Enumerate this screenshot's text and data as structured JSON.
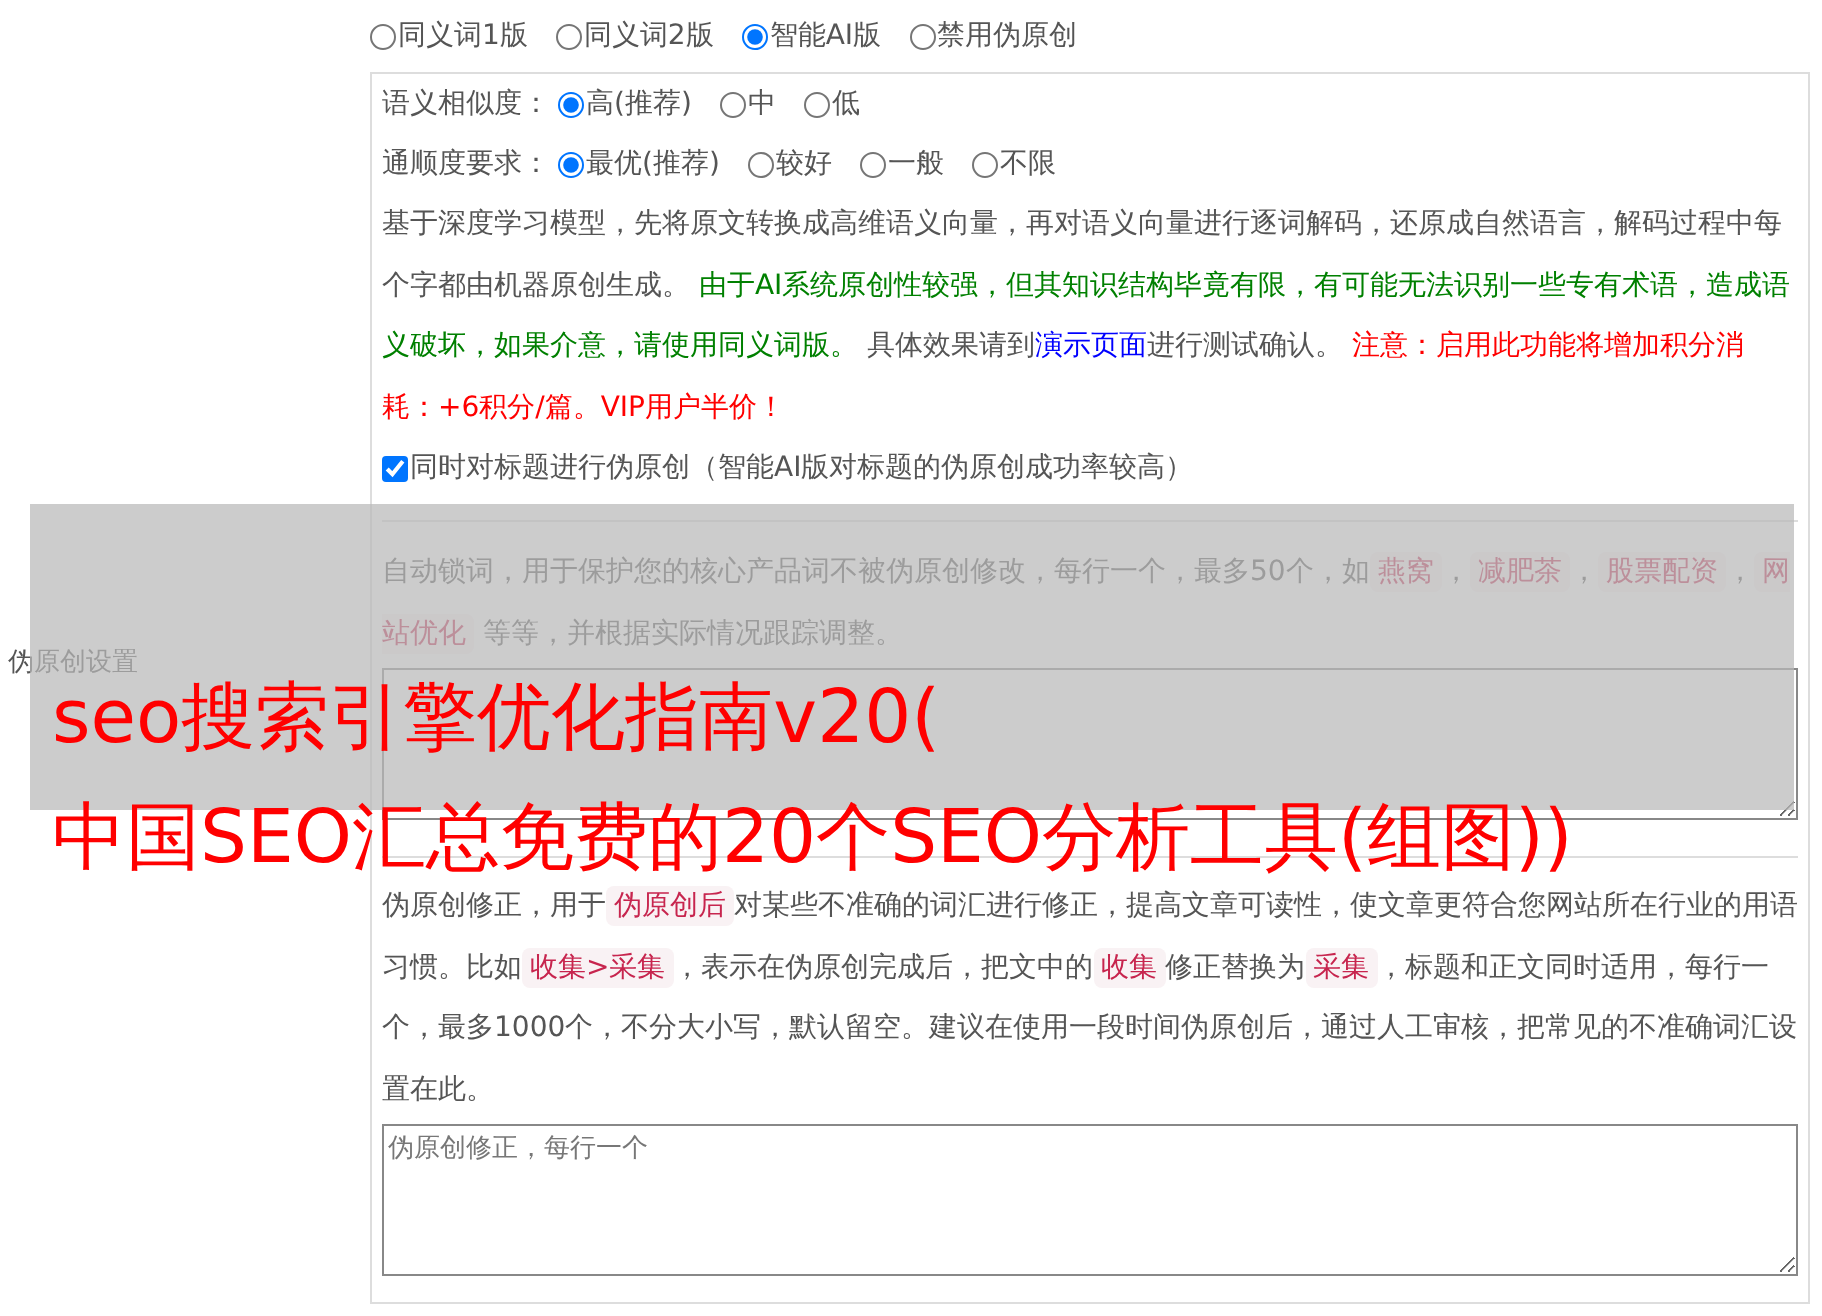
{
  "side_label": "伪原创设置",
  "mode_options": [
    {
      "label": "同义词1版",
      "selected": false
    },
    {
      "label": "同义词2版",
      "selected": false
    },
    {
      "label": "智能AI版",
      "selected": true
    },
    {
      "label": "禁用伪原创",
      "selected": false
    }
  ],
  "ai_panel": {
    "similarity": {
      "label": "语义相似度：",
      "options": [
        {
          "label": "高(推荐)",
          "selected": true
        },
        {
          "label": "中",
          "selected": false
        },
        {
          "label": "低",
          "selected": false
        }
      ]
    },
    "fluency": {
      "label": "通顺度要求：",
      "options": [
        {
          "label": "最优(推荐)",
          "selected": true
        },
        {
          "label": "较好",
          "selected": false
        },
        {
          "label": "一般",
          "selected": false
        },
        {
          "label": "不限",
          "selected": false
        }
      ]
    },
    "description": [
      {
        "kind": "plain",
        "text": "基于深度学习模型，先将原文转换成高维语义向量，再对语义向量进行逐词解码，还原成自然语言，解码过程中每个字都由机器原创生成。 "
      },
      {
        "kind": "note",
        "text": "由于AI系统原创性较强，但其知识结构毕竟有限，有可能无法识别一些专有术语，造成语义破坏，如果介意，请使用同义词版。"
      },
      {
        "kind": "plain",
        "text": " 具体效果请到"
      },
      {
        "kind": "link",
        "text": "演示页面"
      },
      {
        "kind": "plain",
        "text": "进行测试确认。 "
      },
      {
        "kind": "warning",
        "text": "注意：启用此功能将增加积分消耗：+6积分/篇。VIP用户半价！"
      }
    ],
    "title_option": {
      "label": "同时对标题进行伪原创（智能AI版对标题的伪原创成功率较高）",
      "checked": true
    }
  },
  "lock_words": {
    "description": [
      {
        "kind": "plain",
        "text": "自动锁词，用于保护您的核心产品词不被伪原创修改，每行一个，最多50个，如"
      },
      {
        "kind": "code",
        "text": "燕窝"
      },
      {
        "kind": "plain",
        "text": "，"
      },
      {
        "kind": "code",
        "text": "减肥茶"
      },
      {
        "kind": "plain",
        "text": "，"
      },
      {
        "kind": "code",
        "text": "股票配资"
      },
      {
        "kind": "plain",
        "text": "，"
      },
      {
        "kind": "code",
        "text": "网站优化"
      },
      {
        "kind": "plain",
        "text": " 等等，并根据实际情况跟踪调整。"
      }
    ]
  },
  "correction": {
    "description": [
      {
        "kind": "plain",
        "text": "伪原创修正，用于"
      },
      {
        "kind": "code",
        "text": "伪原创后"
      },
      {
        "kind": "plain",
        "text": "对某些不准确的词汇进行修正，提高文章可读性，使文章更符合您网站所在行业的用语习惯。比如"
      },
      {
        "kind": "code",
        "text": "收集>采集"
      },
      {
        "kind": "plain",
        "text": "，表示在伪原创完成后，把文中的"
      },
      {
        "kind": "code",
        "text": "收集"
      },
      {
        "kind": "plain",
        "text": "修正替换为"
      },
      {
        "kind": "code",
        "text": "采集"
      },
      {
        "kind": "plain",
        "text": "，标题和正文同时适用，每行一个，最多1000个，不分大小写，默认留空。建议在使用一段时间伪原创后，通过人工审核，把常见的不准确词汇设置在此。"
      }
    ],
    "placeholder": "伪原创修正，每行一个"
  },
  "overlay_title": [
    "seo搜索引擎优化指南v20(",
    "中国SEO汇总免费的20个SEO分析工具(组图))"
  ]
}
